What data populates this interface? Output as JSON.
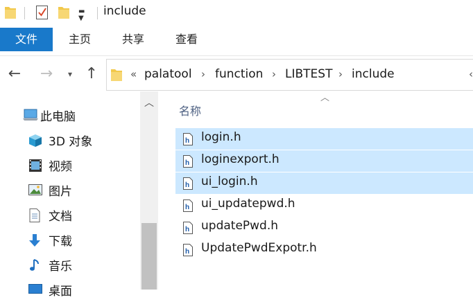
{
  "window": {
    "title": "include"
  },
  "ribbon": {
    "tabs": [
      {
        "label": "文件",
        "active": true
      },
      {
        "label": "主页"
      },
      {
        "label": "共享"
      },
      {
        "label": "查看"
      }
    ],
    "accent_color": "#1979ca"
  },
  "address": {
    "overflow": "«",
    "path": [
      "palatool",
      "function",
      "LIBTEST",
      "include"
    ],
    "separator": "›"
  },
  "nav": {
    "items": [
      {
        "label": "此电脑",
        "icon": "this-pc-icon"
      },
      {
        "label": "3D 对象",
        "icon": "3d-objects-icon"
      },
      {
        "label": "视频",
        "icon": "videos-icon"
      },
      {
        "label": "图片",
        "icon": "pictures-icon"
      },
      {
        "label": "文档",
        "icon": "documents-icon"
      },
      {
        "label": "下载",
        "icon": "downloads-icon"
      },
      {
        "label": "音乐",
        "icon": "music-icon"
      },
      {
        "label": "桌面",
        "icon": "desktop-icon"
      }
    ]
  },
  "files": {
    "column_name": "名称",
    "selection_color": "#cce8ff",
    "items": [
      {
        "name": "login.h",
        "selected": true
      },
      {
        "name": "loginexport.h",
        "selected": true
      },
      {
        "name": "ui_login.h",
        "selected": true
      },
      {
        "name": "ui_updatepwd.h",
        "selected": false
      },
      {
        "name": "updatePwd.h",
        "selected": false
      },
      {
        "name": "UpdatePwdExpotr.h",
        "selected": false
      }
    ]
  }
}
